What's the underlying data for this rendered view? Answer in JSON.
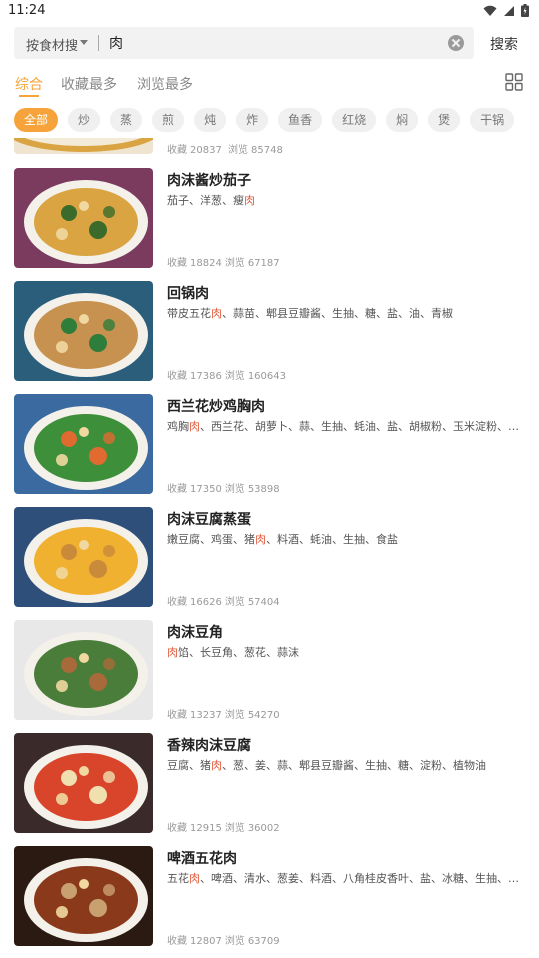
{
  "status": {
    "time": "11:24"
  },
  "search": {
    "type_label": "按食材搜",
    "query": "肉",
    "button_label": "搜索"
  },
  "tabs": [
    {
      "label": "综合",
      "active": true
    },
    {
      "label": "收藏最多",
      "active": false
    },
    {
      "label": "浏览最多",
      "active": false
    }
  ],
  "chips": [
    "全部",
    "炒",
    "蒸",
    "煎",
    "炖",
    "炸",
    "鱼香",
    "红烧",
    "焖",
    "煲",
    "干锅"
  ],
  "stats_labels": {
    "fav": "收藏",
    "view": "浏览"
  },
  "partial_item": {
    "fav": "20837",
    "view": "85748"
  },
  "recipes": [
    {
      "title": "肉沫酱炒茄子",
      "ingredients": [
        "茄子、洋葱、瘦",
        "肉",
        ""
      ],
      "fav": "18824",
      "view": "67187",
      "palette": [
        "#7a3b5e",
        "#d9a441",
        "#3a6b2a"
      ]
    },
    {
      "title": "回锅肉",
      "ingredients": [
        "带皮五花",
        "肉",
        "、蒜苗、郫县豆瓣酱、生抽、糖、盐、油、青椒"
      ],
      "fav": "17386",
      "view": "160643",
      "palette": [
        "#2b5e7a",
        "#c79150",
        "#2f7d3a"
      ]
    },
    {
      "title": "西兰花炒鸡胸肉",
      "ingredients": [
        "鸡胸",
        "肉",
        "、西兰花、胡萝卜、蒜、生抽、蚝油、盐、胡椒粉、玉米淀粉、食..."
      ],
      "fav": "17350",
      "view": "53898",
      "palette": [
        "#3a6aa0",
        "#3e8f3a",
        "#e06a30"
      ]
    },
    {
      "title": "肉沫豆腐蒸蛋",
      "ingredients": [
        "嫩豆腐、鸡蛋、猪",
        "肉",
        "、料酒、蚝油、生抽、食盐"
      ],
      "fav": "16626",
      "view": "57404",
      "palette": [
        "#2d4f7a",
        "#f0b030",
        "#c98b3a"
      ]
    },
    {
      "title": "肉沫豆角",
      "ingredients": [
        "",
        "肉",
        "馅、长豆角、葱花、蒜沫"
      ],
      "fav": "13237",
      "view": "54270",
      "palette": [
        "#e8e8e8",
        "#4a7d3a",
        "#a86a3a"
      ]
    },
    {
      "title": "香辣肉沫豆腐",
      "ingredients": [
        "豆腐、猪",
        "肉",
        "、葱、姜、蒜、郫县豆瓣酱、生抽、糖、淀粉、植物油"
      ],
      "fav": "12915",
      "view": "36002",
      "palette": [
        "#3a2a2a",
        "#d8452a",
        "#f0e0b0"
      ]
    },
    {
      "title": "啤酒五花肉",
      "ingredients": [
        "五花",
        "肉",
        "、啤酒、清水、葱姜、料酒、八角桂皮香叶、盐、冰糖、生抽、耗..."
      ],
      "fav": "12807",
      "view": "63709",
      "palette": [
        "#2a1a12",
        "#8a3a1a",
        "#c9a070"
      ]
    }
  ]
}
